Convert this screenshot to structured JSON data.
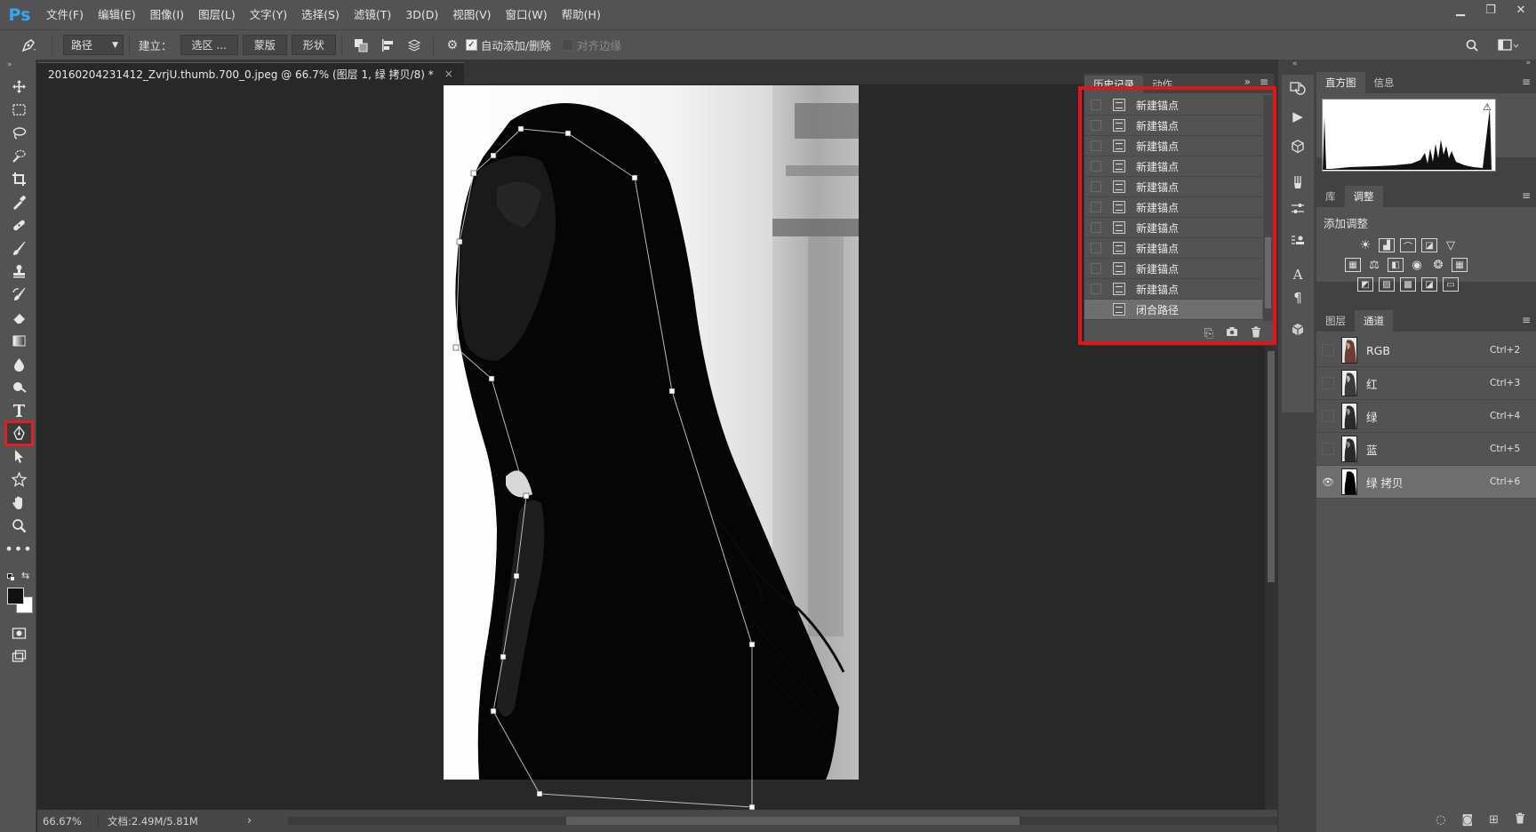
{
  "app": {
    "logo": "Ps"
  },
  "menu": [
    "文件(F)",
    "编辑(E)",
    "图像(I)",
    "图层(L)",
    "文字(Y)",
    "选择(S)",
    "滤镜(T)",
    "3D(D)",
    "视图(V)",
    "窗口(W)",
    "帮助(H)"
  ],
  "window_controls": {
    "minimize": "▁",
    "restore": "❐",
    "close": "✕"
  },
  "options": {
    "mode": "路径",
    "make_label": "建立：",
    "selection_btn": "选区 ...",
    "mask_btn": "蒙版",
    "shape_btn": "形状",
    "auto_add_delete": "自动添加/删除",
    "align_edges": "对齐边缘"
  },
  "document": {
    "tab_title": "20160204231412_ZvrjU.thumb.700_0.jpeg @ 66.7% (图层 1, 绿 拷贝/8) *",
    "tab_close": "×"
  },
  "status": {
    "zoom": "66.67%",
    "doc_info": "文档:2.49M/5.81M",
    "arrow": "›"
  },
  "history_panel": {
    "tabs": [
      "历史记录",
      "动作"
    ],
    "expand": "»",
    "menu": "≡",
    "items": [
      "新建锚点",
      "新建锚点",
      "新建锚点",
      "新建锚点",
      "新建锚点",
      "新建锚点",
      "新建锚点",
      "新建锚点",
      "新建锚点",
      "新建锚点",
      "闭合路径"
    ],
    "selected_index": 10
  },
  "histogram_panel": {
    "tabs": [
      "直方图",
      "信息"
    ],
    "warning": "⚠"
  },
  "adjustments_panel": {
    "tabs": [
      "库",
      "调整"
    ],
    "title": "添加调整"
  },
  "channels_panel": {
    "tabs": [
      "图层",
      "通道"
    ],
    "channels": [
      {
        "name": "RGB",
        "shortcut": "Ctrl+2",
        "visible": false
      },
      {
        "name": "红",
        "shortcut": "Ctrl+3",
        "visible": false
      },
      {
        "name": "绿",
        "shortcut": "Ctrl+4",
        "visible": false
      },
      {
        "name": "蓝",
        "shortcut": "Ctrl+5",
        "visible": false
      },
      {
        "name": "绿 拷贝",
        "shortcut": "Ctrl+6",
        "visible": true
      }
    ],
    "selected_index": 4
  },
  "colors": {
    "highlight": "#e3141a",
    "ps_blue": "#31a8ff"
  }
}
